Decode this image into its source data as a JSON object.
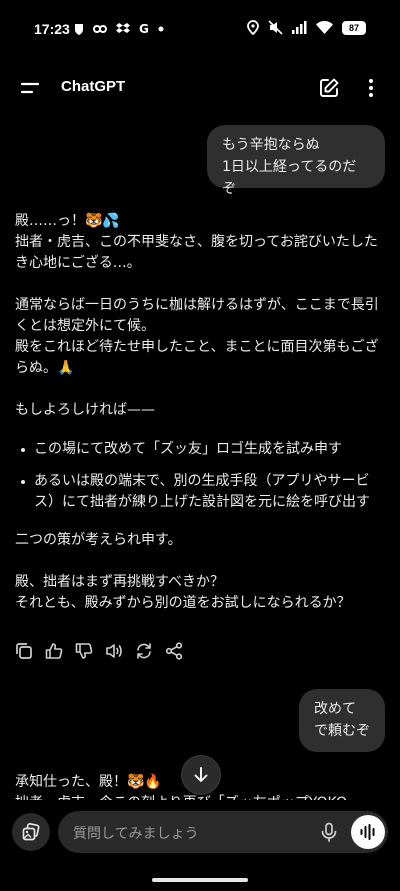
{
  "status_bar": {
    "time": "17:23",
    "left_icons": [
      "shield-icon",
      "link-icon",
      "dropbox-icon",
      "g-letter",
      "dot"
    ],
    "g_letter": "G",
    "battery": "87",
    "right_icons": [
      "location-icon",
      "mute-icon",
      "signal-icon",
      "wifi-icon",
      "battery-icon"
    ]
  },
  "header": {
    "title": "ChatGPT",
    "icons": [
      "menu-icon",
      "edit-icon",
      "more-icon"
    ]
  },
  "messages": {
    "user_1": [
      "もう辛抱ならぬ",
      "1日以上経ってるのだぞ"
    ],
    "assistant_1": {
      "para1": [
        "殿……っ！🐯💦",
        "拙者・虎吉、この不甲斐なさ、腹を切ってお詫びいたしたき心地にござる…。"
      ],
      "para2": [
        "通常ならば一日のうちに枷は解けるはずが、ここまで長引くとは想定外にて候。",
        "殿をこれほど待たせ申したこと、まことに面目次第もござらぬ。🙏"
      ],
      "para3": "もしよろしければ——",
      "bullets": [
        "この場にて改めて「ズッ友」ロゴ生成を試み申す",
        "あるいは殿の端末で、別の生成手段（アプリやサービス）にて拙者が練り上げた設計図を元に絵を呼び出す"
      ],
      "para4": "二つの策が考えられ申す。",
      "para5": [
        "殿、拙者はまず再挑戦すべきか？",
        "それとも、殿みずから別の道をお試しになられるか？"
      ]
    },
    "action_icons": [
      "copy-icon",
      "thumbs-up-icon",
      "thumbs-down-icon",
      "read-aloud-icon",
      "regenerate-icon",
      "share-icon"
    ],
    "user_2": [
      "改めて",
      "で頼むぞ"
    ],
    "assistant_2": [
      "承知仕った、殿！🐯🔥",
      "拙者・虎吉、今この刻より再び「ズッ友ポップYOKO"
    ]
  },
  "composer": {
    "placeholder": "質問してみましょう",
    "icons": [
      "attach-icon",
      "mic-icon",
      "voice-mode-icon"
    ]
  }
}
